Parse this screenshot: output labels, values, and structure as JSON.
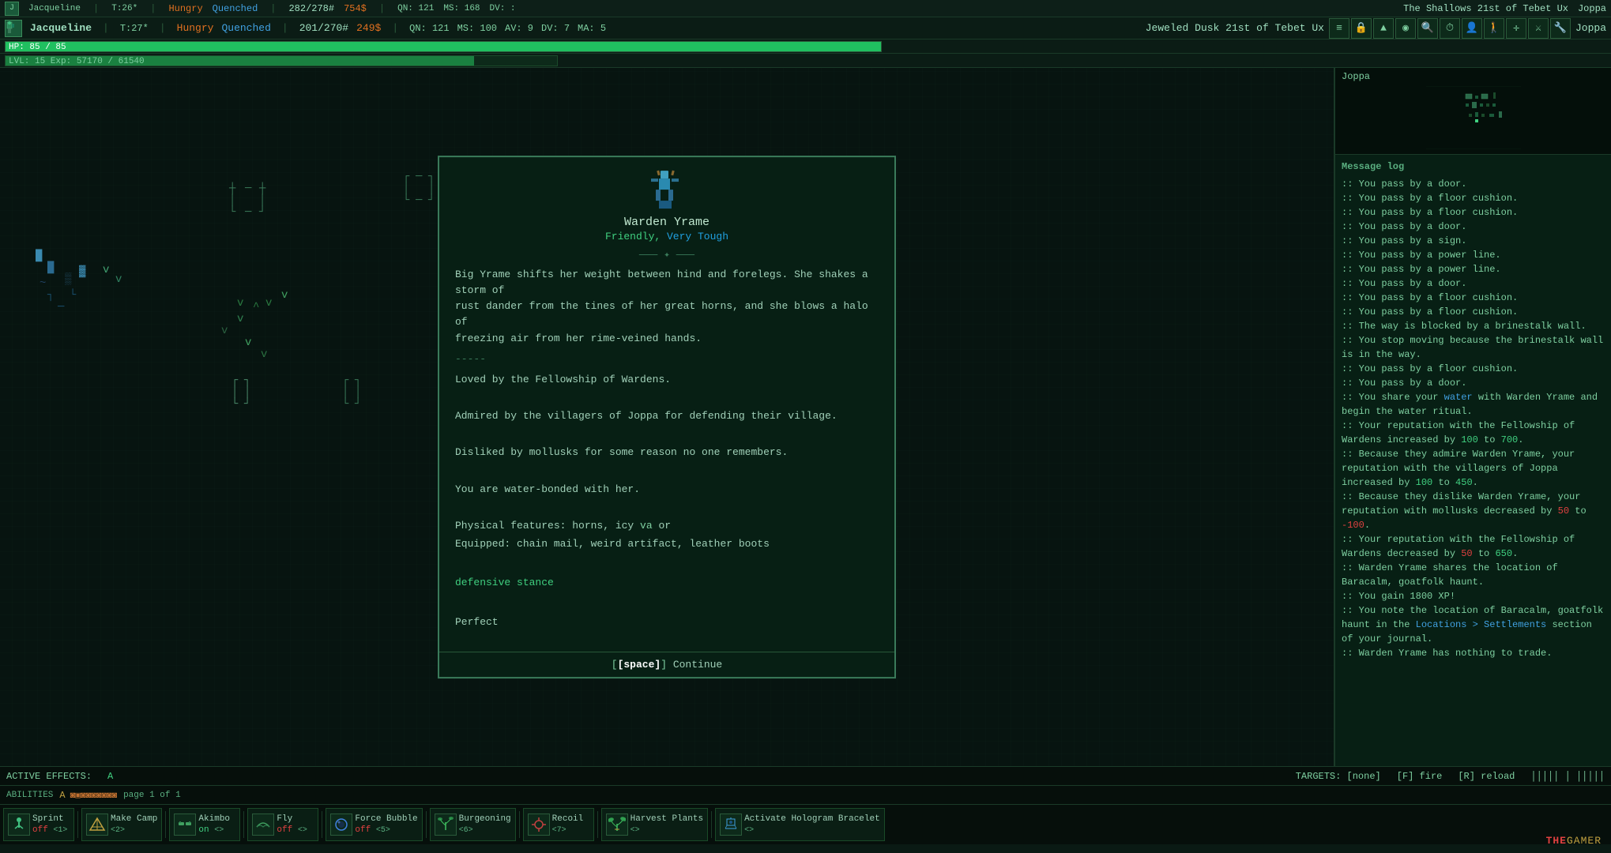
{
  "topbar": {
    "avatar_char": "J",
    "char_name": "Jacqueline",
    "t_val": "T:26*",
    "hunger": "Hungry",
    "hunger_state": "Quenched",
    "hp": "282/278#",
    "gold": "754$",
    "qn": "QN: 121",
    "ms": "MS: 168",
    "dv": "DV: :",
    "location": "The Shallows 21st of Tebet Ux",
    "place": "Joppa"
  },
  "statsbar": {
    "avatar_char": "J",
    "char_name": "Jacqueline",
    "t_val": "T:27*",
    "hunger": "Hungry",
    "hunger_state": "Quenched",
    "hp": "201/270#",
    "gold": "249$",
    "qn": "QN: 121",
    "ms": "MS: 100",
    "av": "AV: 9",
    "dv": "DV: 7",
    "ma": "MA: 5",
    "location": "Jeweled Dusk 21st of Tebet Ux",
    "place": "Joppa"
  },
  "hpbar": {
    "text": "HP: 85 / 85",
    "fill_pct": 100
  },
  "expbar": {
    "text": "LVL: 15  Exp: 57170 / 61540",
    "fill_pct": 85
  },
  "minimap": {
    "label": "Joppa",
    "content": "□ □□□  ñ\n□ □□ □□\n    □  □\n  □□□ □ □"
  },
  "dialog": {
    "npc_sprite": "🦬",
    "npc_name": "Warden Yrame",
    "status_friendly": "Friendly,",
    "status_tough": "Very Tough",
    "separator": "——— ✦ ———",
    "body_text": "Big Yrame shifts her weight between hind and forelegs. She shakes a storm of\nrust dander from the tines of her great horns, and she blows a halo of\nfreezing air from her rime-veined hands.",
    "dash_line": "-----",
    "trait1": "Loved by the Fellowship of Wardens.",
    "trait2": "Admired by the villagers of Joppa for defending their village.",
    "trait3": "Disliked by mollusks for some reason no one remembers.",
    "water_bond": "You are water-bonded with her.",
    "physical": "Physical features: horns, icy va or",
    "equipped": "Equipped: chain mail, weird artifact, leather boots",
    "stance": "defensive stance",
    "perfect": "Perfect",
    "continue_key": "[space]",
    "continue_label": "Continue"
  },
  "message_log": {
    "header": "Message log",
    "messages": [
      ":: You pass by a door.",
      ":: You pass by a floor cushion.",
      ":: You pass by a floor cushion.",
      ":: You pass by a door.",
      ":: You pass by a sign.",
      ":: You pass by a power line.",
      ":: You pass by a power line.",
      ":: You pass by a door.",
      ":: You pass by a floor cushion.",
      ":: You pass by a floor cushion.",
      ":: The way is blocked by a brinestalk wall.",
      ":: You stop moving because the brinestalk wall is in the way.",
      ":: You pass by a floor cushion.",
      ":: You pass by a door.",
      ":: You share your water with Warden Yrame and begin the water ritual.",
      ":: Your reputation with the Fellowship of Wardens increased by 100 to 700.",
      ":: Because they admire Warden Yrame, your reputation with the villagers of Joppa increased by 100 to 450.",
      ":: Because they dislike Warden Yrame, your reputation with mollusks decreased by 50 to -100.",
      ":: Your reputation with the Fellowship of Wardens decreased by 50 to 650.",
      ":: Warden Yrame shares the location of Baracalm, goatfolk haunt.",
      ":: You gain 1800 XP!",
      ":: You note the location of Baracalm, goatfolk haunt in the Locations > Settlements section of your journal.",
      ":: Warden Yrame has nothing to trade."
    ],
    "water_link": "water",
    "num_100_pos": "100",
    "num_700": "700",
    "num_100_pos2": "100",
    "num_450": "450",
    "num_50_neg": "50",
    "num_neg100": "-100",
    "num_50_neg2": "50",
    "num_650": "650",
    "settlements_link": "Locations > Settlements"
  },
  "statusline": {
    "active_effects": "ACTIVE EFFECTS:",
    "effect_a": "A",
    "targets": "TARGETS: [none]",
    "fire_key": "[F] fire",
    "reload_key": "[R] reload"
  },
  "abilities": {
    "label": "ABILITIES",
    "page": "page 1 of 1"
  },
  "hotbar": [
    {
      "icon": "🏃",
      "name": "Sprint",
      "state": "off",
      "key": "<1>"
    },
    {
      "icon": "⛺",
      "name": "Make Camp",
      "state": "",
      "key": "<2>"
    },
    {
      "icon": "🤸",
      "name": "Akimbo",
      "state": "on",
      "key": "<>"
    },
    {
      "icon": "🕊",
      "name": "Fly",
      "state": "off",
      "key": "<>"
    },
    {
      "icon": "🔵",
      "name": "Force Bubble",
      "state": "off",
      "key": "<5>"
    },
    {
      "icon": "🌿",
      "name": "Burgeoning",
      "state": "",
      "key": "<6>"
    },
    {
      "icon": "💥",
      "name": "Recoil",
      "state": "",
      "key": "<7>"
    },
    {
      "icon": "🌱",
      "name": "Harvest Plants",
      "state": "",
      "key": "<>"
    },
    {
      "icon": "💡",
      "name": "Activate Hologram Bracelet",
      "state": "",
      "key": "<>"
    }
  ],
  "watermark": "THEGAMER"
}
